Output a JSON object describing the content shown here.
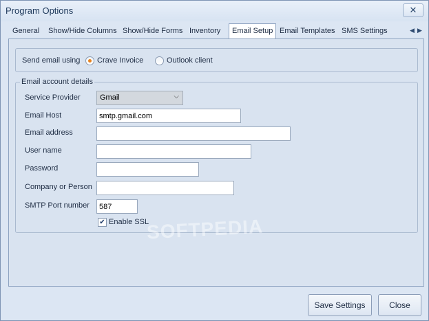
{
  "window": {
    "title": "Program Options",
    "close_glyph": "✕"
  },
  "tabs": [
    {
      "label": "General"
    },
    {
      "label": "Show/Hide Columns"
    },
    {
      "label": "Show/Hide Forms"
    },
    {
      "label": "Inventory"
    },
    {
      "label": "Email Setup"
    },
    {
      "label": "Email Templates"
    },
    {
      "label": "SMS Settings"
    }
  ],
  "tab_scroll": {
    "left_icon": "chevron-left-icon",
    "right_icon": "chevron-right-icon",
    "left_glyph": "◀",
    "right_glyph": "▶"
  },
  "send_email": {
    "label": "Send email using",
    "options": [
      {
        "label": "Crave Invoice",
        "selected": true
      },
      {
        "label": "Outlook client",
        "selected": false
      }
    ]
  },
  "account": {
    "legend": "Email account details",
    "service_provider_label": "Service Provider",
    "service_provider_value": "Gmail",
    "email_host_label": "Email Host",
    "email_host_value": "smtp.gmail.com",
    "email_address_label": "Email address",
    "email_address_value": "",
    "user_name_label": "User name",
    "user_name_value": "",
    "password_label": "Password",
    "password_value": "",
    "company_label": "Company or Person",
    "company_value": "",
    "smtp_port_label": "SMTP Port number",
    "smtp_port_value": "587",
    "enable_ssl_label": "Enable SSL",
    "enable_ssl_checked": true,
    "check_glyph": "✔"
  },
  "watermark": "SOFTPEDIA",
  "buttons": {
    "save_label": "Save Settings",
    "close_label": "Close"
  }
}
